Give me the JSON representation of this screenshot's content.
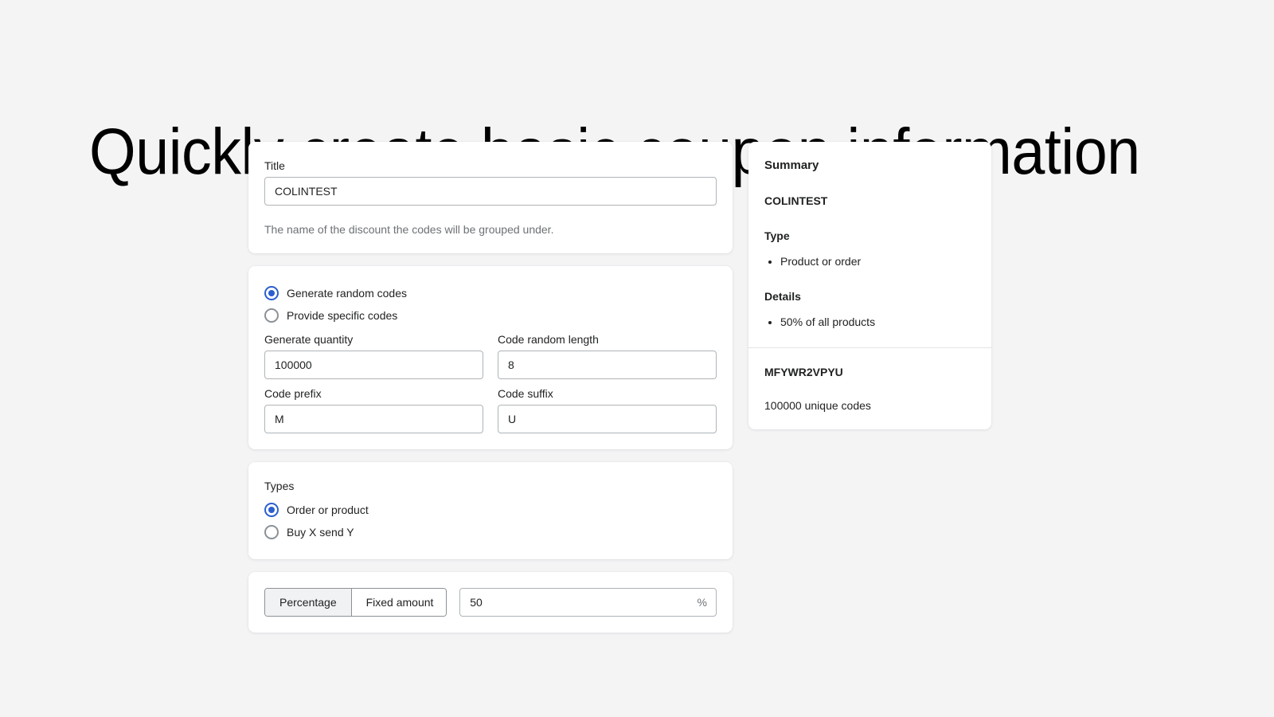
{
  "page": {
    "title": "Quickly create basic coupon information",
    "background_color": "#f4f4f5",
    "accent_color": "#2c5ecf"
  },
  "title_card": {
    "label": "Title",
    "value": "COLINTEST",
    "placeholder": "",
    "help_text": "The name of the discount the codes will be grouped under."
  },
  "codes_card": {
    "mode_options": [
      {
        "label": "Generate random codes",
        "selected": true
      },
      {
        "label": "Provide specific codes",
        "selected": false
      }
    ],
    "fields": [
      {
        "label": "Generate quantity",
        "value": "100000"
      },
      {
        "label": "Code random length",
        "value": "8"
      },
      {
        "label": "Code prefix",
        "value": "M"
      },
      {
        "label": "Code suffix",
        "value": "U"
      }
    ]
  },
  "types_card": {
    "label": "Types",
    "options": [
      {
        "label": "Order or product",
        "selected": true
      },
      {
        "label": "Buy X send Y",
        "selected": false
      }
    ]
  },
  "value_card": {
    "segments": [
      {
        "label": "Percentage",
        "selected": true
      },
      {
        "label": "Fixed amount",
        "selected": false
      }
    ],
    "amount": {
      "value": "50",
      "suffix": "%",
      "placeholder": ""
    }
  },
  "summary": {
    "heading": "Summary",
    "discount_title": "COLINTEST",
    "type_heading": "Type",
    "type_items": [
      "Product or order"
    ],
    "details_heading": "Details",
    "details_items": [
      "50% of all products"
    ],
    "code_sample": "MFYWR2VPYU",
    "code_count_text": "100000 unique codes"
  }
}
